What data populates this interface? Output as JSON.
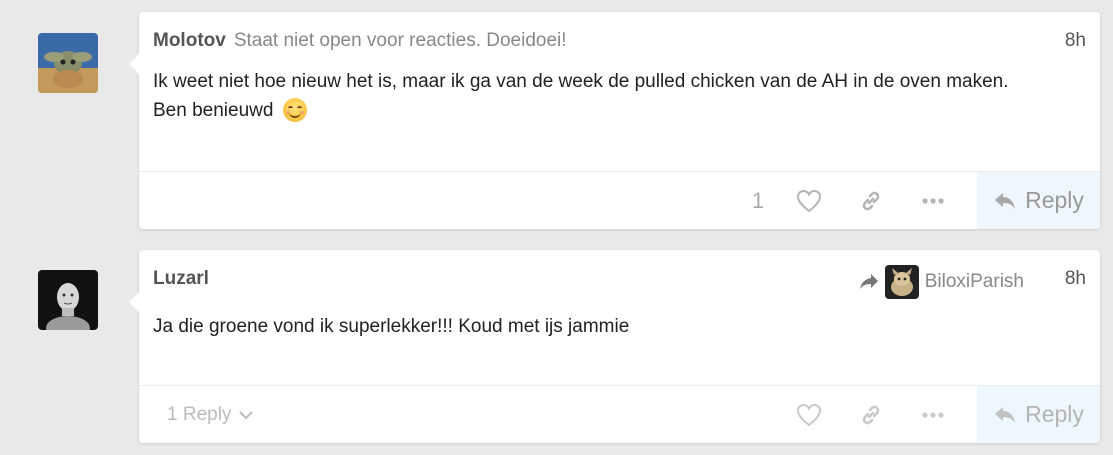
{
  "posts": [
    {
      "username": "Molotov",
      "user_title": "Staat niet open voor reacties. Doeidoei!",
      "age": "8h",
      "body_line1": "Ik weet niet hoe nieuw het is, maar ik ga van de week de pulled chicken van de AH in de oven maken.",
      "body_line2": "Ben benieuwd",
      "emoji": "smiling-face-emoji",
      "like_count": "1",
      "reply_label": "Reply"
    },
    {
      "username": "Luzarl",
      "age": "8h",
      "reply_to_user": "BiloxiParish",
      "body": "Ja die groene vond ik superlekker!!! Koud met ijs jammie",
      "replies_label": "1 Reply",
      "reply_label": "Reply"
    }
  ],
  "icons": {
    "like": "heart-icon",
    "link": "link-icon",
    "more": "ellipsis-icon",
    "reply": "reply-arrow-icon",
    "reply_to": "share-arrow-icon",
    "expand": "chevron-down-icon"
  },
  "colors": {
    "background": "#e9e9e9",
    "card": "#ffffff",
    "reply_button_bg": "#eef7fd",
    "muted": "#999999"
  }
}
